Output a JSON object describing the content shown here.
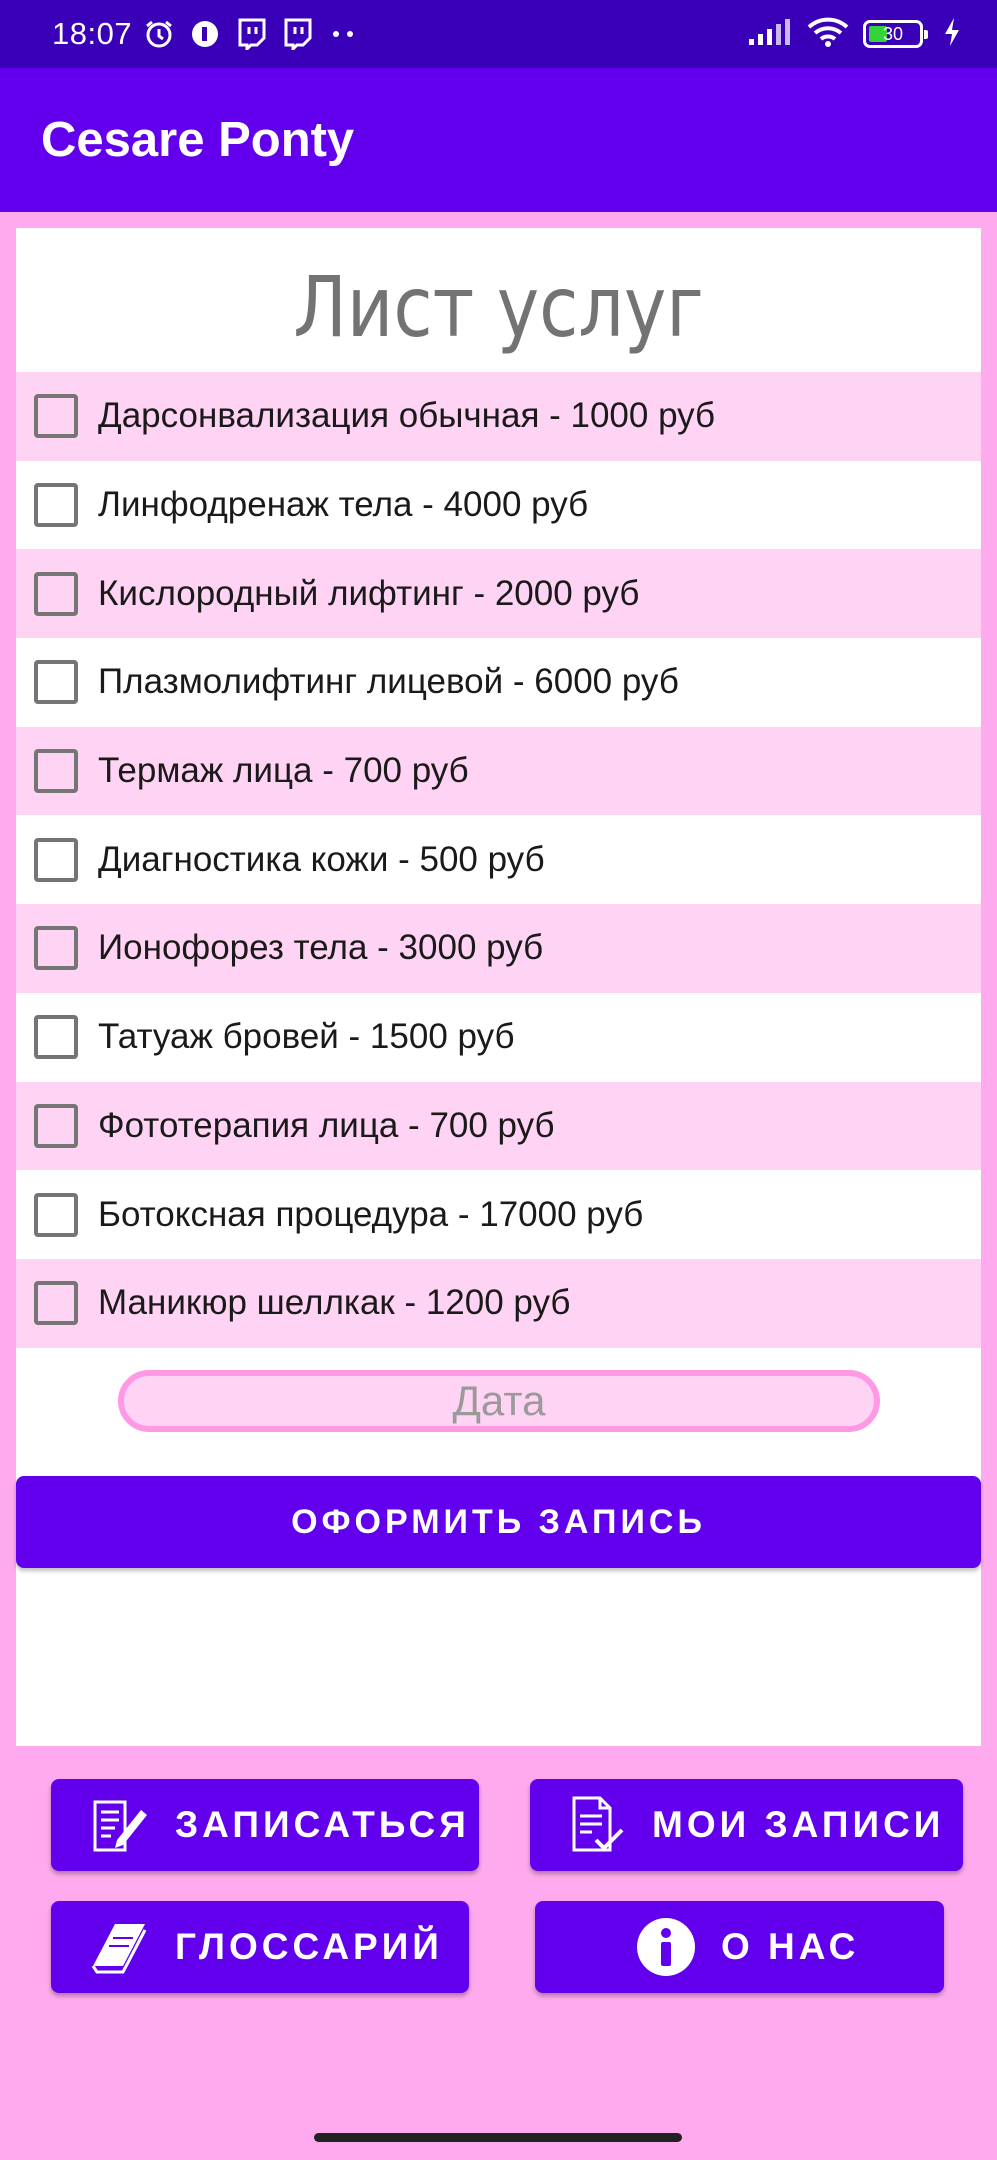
{
  "status_bar": {
    "time": "18:07",
    "battery": "30",
    "icons_left": [
      "alarm-icon",
      "notification-app-icon",
      "twitch-icon",
      "twitch-icon",
      "more-dots-icon"
    ],
    "icons_right": [
      "signal-icon",
      "wifi-icon",
      "battery-icon",
      "charging-icon"
    ]
  },
  "app_bar": {
    "title": "Cesare Ponty"
  },
  "sheet": {
    "title": "Лист услуг",
    "services": [
      {
        "label": "Дарсонвализация обычная - 1000 руб",
        "checked": false
      },
      {
        "label": "Линфодренаж тела - 4000 руб",
        "checked": false
      },
      {
        "label": "Кислородный лифтинг - 2000 руб",
        "checked": false
      },
      {
        "label": "Плазмолифтинг лицевой - 6000 руб",
        "checked": false
      },
      {
        "label": "Термаж лица - 700 руб",
        "checked": false
      },
      {
        "label": "Диагностика кожи - 500 руб",
        "checked": false
      },
      {
        "label": "Ионофорез тела - 3000 руб",
        "checked": false
      },
      {
        "label": "Татуаж бровей - 1500 руб",
        "checked": false
      },
      {
        "label": "Фототерапия лица - 700 руб",
        "checked": false
      },
      {
        "label": "Ботоксная процедура - 17000 руб",
        "checked": false
      },
      {
        "label": "Маникюр шеллкак - 1200 руб",
        "checked": false
      }
    ],
    "date_placeholder": "Дата",
    "book_button": "ОФОРМИТЬ ЗАПИСЬ"
  },
  "nav": {
    "signup": "ЗАПИСАТЬСЯ",
    "my_records": "МОИ ЗАПИСИ",
    "glossary": "ГЛОССАРИЙ",
    "about": "О НАС"
  },
  "colors": {
    "primary": "#6200ee",
    "status_bar": "#3a00b8",
    "background": "#ffaaee",
    "row_alt": "#ffd3f3"
  }
}
